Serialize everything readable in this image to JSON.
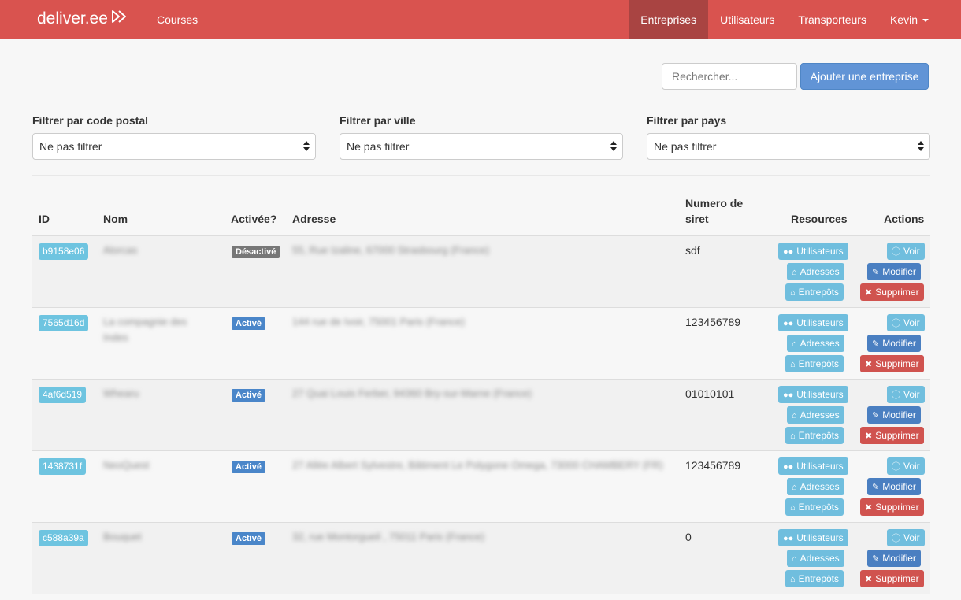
{
  "brand": {
    "name": "deliver.ee"
  },
  "nav": {
    "courses": "Courses",
    "entreprises": "Entreprises",
    "utilisateurs": "Utilisateurs",
    "transporteurs": "Transporteurs",
    "user": "Kevin"
  },
  "toolbar": {
    "search_placeholder": "Rechercher...",
    "add_label": "Ajouter une entreprise"
  },
  "filters": [
    {
      "label": "Filtrer par code postal",
      "value": "Ne pas filtrer"
    },
    {
      "label": "Filtrer par ville",
      "value": "Ne pas filtrer"
    },
    {
      "label": "Filtrer par pays",
      "value": "Ne pas filtrer"
    }
  ],
  "table": {
    "headers": {
      "id": "ID",
      "nom": "Nom",
      "activee": "Activée?",
      "adresse": "Adresse",
      "siret_1": "Numero de",
      "siret_2": "siret",
      "resources": "Resources",
      "actions": "Actions"
    },
    "resource_labels": {
      "utilisateurs": "Utilisateurs",
      "adresses": "Adresses",
      "entrepots": "Entrepôts"
    },
    "action_labels": {
      "voir": "Voir",
      "modifier": "Modifier",
      "supprimer": "Supprimer"
    },
    "rows": [
      {
        "id": "b9158e06",
        "nom": "Alorcas",
        "status": "Désactivé",
        "adresse": "55, Rue Izaline, 67000 Strasbourg (France)",
        "siret": "sdf"
      },
      {
        "id": "7565d16d",
        "nom": "La compagnie des Indes",
        "status": "Activé",
        "adresse": "144 rue de Ivoir, 75001 Paris (France)",
        "siret": "123456789"
      },
      {
        "id": "4af6d519",
        "nom": "Whearu",
        "status": "Activé",
        "adresse": "27 Quai Louis Ferber, 94360 Bry-sur-Marne (France)",
        "siret": "01010101"
      },
      {
        "id": "1438731f",
        "nom": "NeoQuest",
        "status": "Activé",
        "adresse": "27 Allée Albert Sylvestre, Bâtiment Le Polygone Omega, 73000 CHAMBERY (FR)",
        "siret": "123456789"
      },
      {
        "id": "c588a39a",
        "nom": "Bouquet",
        "status": "Activé",
        "adresse": "32, rue Montorgueil , 75011 Paris (France)",
        "siret": "0"
      }
    ]
  }
}
